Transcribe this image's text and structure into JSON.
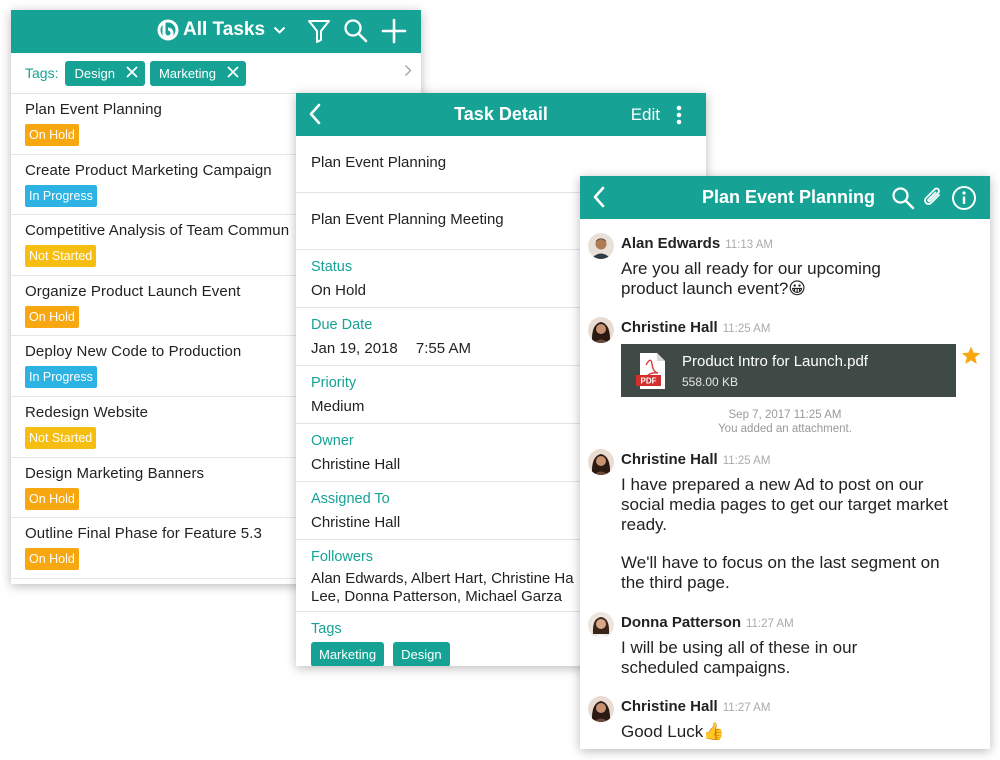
{
  "task_list": {
    "title": "All Tasks",
    "tags_label": "Tags:",
    "tags": [
      "Design",
      "Marketing"
    ],
    "status_colors": {
      "On Hold": "#f7a70f",
      "In Progress": "#2cb3e3",
      "Not Started": "#f5be10"
    },
    "tasks": [
      {
        "title": "Plan Event Planning",
        "status": "On Hold"
      },
      {
        "title": "Create Product Marketing Campaign",
        "status": "In Progress"
      },
      {
        "title": "Competitive Analysis of Team Commun",
        "status": "Not Started"
      },
      {
        "title": "Organize Product Launch Event",
        "status": "On Hold"
      },
      {
        "title": "Deploy New Code to Production",
        "status": "In Progress"
      },
      {
        "title": "Redesign Website",
        "status": "Not Started"
      },
      {
        "title": "Design Marketing Banners",
        "status": "On Hold"
      },
      {
        "title": "Outline Final Phase for Feature 5.3",
        "status": "On Hold"
      }
    ]
  },
  "task_detail": {
    "title": "Task Detail",
    "edit_label": "Edit",
    "name": "Plan Event Planning",
    "description": "Plan Event Planning Meeting",
    "status_label": "Status",
    "status_value": "On Hold",
    "due_label": "Due Date",
    "due_date": "Jan 19, 2018",
    "due_time": "7:55 AM",
    "priority_label": "Priority",
    "priority_value": "Medium",
    "owner_label": "Owner",
    "owner_value": "Christine Hall",
    "assigned_label": "Assigned To",
    "assigned_value": "Christine Hall",
    "followers_label": "Followers",
    "followers_value": "Alan Edwards, Albert Hart, Christine Ha Lee, Donna Patterson, Michael Garza",
    "tags_label": "Tags",
    "tags": [
      "Marketing",
      "Design"
    ]
  },
  "chat": {
    "title": "Plan Event Planning",
    "messages": [
      {
        "author": "Alan Edwards",
        "time": "11:13 AM",
        "text": "Are you all ready for our upcoming product launch event?😀"
      },
      {
        "author": "Christine Hall",
        "time": "11:25 AM",
        "attachment": {
          "name": "Product Intro for Launch.pdf",
          "size": "558.00 KB",
          "badge": "PDF"
        }
      },
      {
        "author": "Christine Hall",
        "time": "11:25 AM",
        "text": "I have prepared a new Ad to post on our social media pages to get our target market ready.",
        "text2": "We'll have to focus on the last segment on the third page."
      },
      {
        "author": "Donna Patterson",
        "time": "11:27 AM",
        "text": "I will be using all of these in our scheduled campaigns."
      },
      {
        "author": "Christine Hall",
        "time": "11:27 AM",
        "text": "Good Luck👍"
      }
    ],
    "system_note": {
      "date": "Sep 7, 2017 11:25 AM",
      "text": "You added an attachment."
    }
  },
  "colors": {
    "accent": "#16a395",
    "attachment_bg": "#3f4a46",
    "star": "#f7a70f"
  }
}
